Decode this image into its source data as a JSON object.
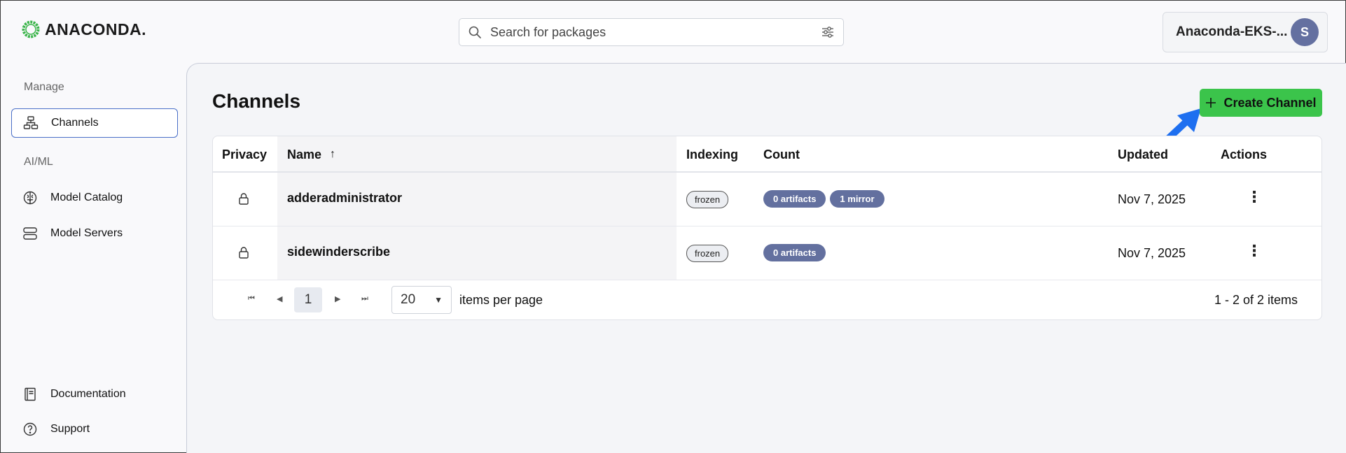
{
  "header": {
    "logo_text": "ANACONDA.",
    "search_placeholder": "Search for packages",
    "account_name": "Anaconda-EKS-...",
    "avatar_initial": "S"
  },
  "sidebar": {
    "sections": [
      {
        "title": "Manage"
      },
      {
        "title": "AI/ML"
      }
    ],
    "items": {
      "channels": {
        "label": "Channels",
        "icon": "channels-icon"
      },
      "model_catalog": {
        "label": "Model Catalog",
        "icon": "brain-icon"
      },
      "model_servers": {
        "label": "Model Servers",
        "icon": "server-icon"
      },
      "documentation": {
        "label": "Documentation",
        "icon": "book-icon"
      },
      "support": {
        "label": "Support",
        "icon": "help-icon"
      }
    }
  },
  "main": {
    "title": "Channels",
    "create_button": "Create Channel",
    "columns": {
      "privacy": "Privacy",
      "name": "Name",
      "indexing": "Indexing",
      "count": "Count",
      "updated": "Updated",
      "actions": "Actions"
    },
    "rows": [
      {
        "privacy": "lock-icon",
        "name": "adderadministrator",
        "indexing": "frozen",
        "artifacts": "0 artifacts",
        "mirrors": "1 mirror",
        "updated": "Nov 7, 2025"
      },
      {
        "privacy": "lock-icon",
        "name": "sidewinderscribe",
        "indexing": "frozen",
        "artifacts": "0 artifacts",
        "updated": "Nov 7, 2025"
      }
    ],
    "pagination": {
      "current_page": "1",
      "page_size": "20",
      "items_per_page_label": "items per page",
      "range_label": "1 - 2 of 2 items"
    }
  },
  "colors": {
    "accent_green": "#3bc44b",
    "pill_blue": "#63709f",
    "active_border": "#4a6fc7",
    "annotation_arrow": "#1e6ff0"
  }
}
